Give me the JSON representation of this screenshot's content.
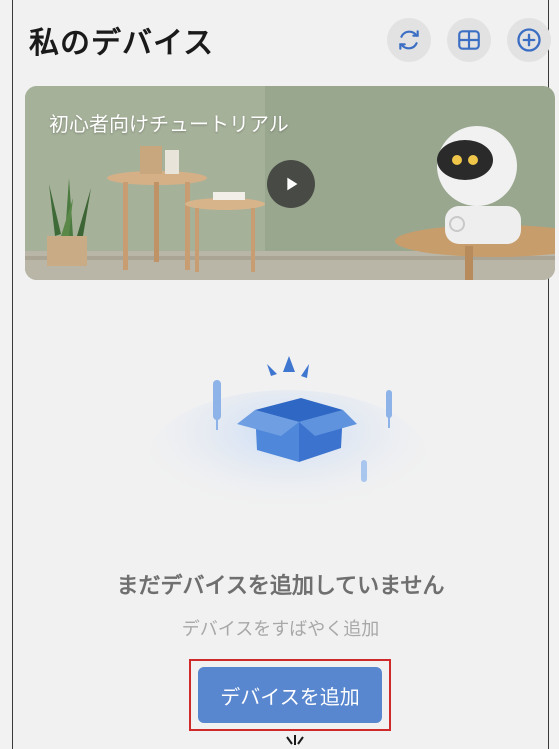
{
  "header": {
    "title": "私のデバイス",
    "icons": [
      "refresh-icon",
      "grid-icon",
      "add-circle-icon"
    ]
  },
  "banner": {
    "title": "初心者向けチュートリアル",
    "play_icon": "play-icon"
  },
  "empty_state": {
    "title": "まだデバイスを追加していません",
    "subtitle": "デバイスをすばやく追加",
    "button_label": "デバイスを追加"
  },
  "colors": {
    "accent": "#5886cf",
    "highlight_border": "#d0292b",
    "icon_blue": "#3c6fc4"
  }
}
